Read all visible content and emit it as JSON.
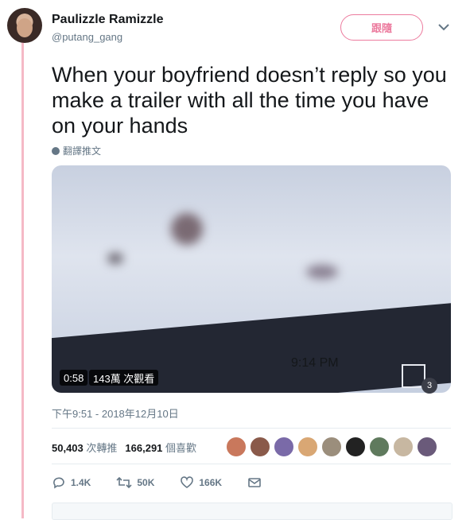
{
  "user": {
    "display_name": "Paulizzle Ramizzle",
    "handle": "@putang_gang"
  },
  "follow_button_label": "跟隨",
  "tweet": {
    "text": "When your boyfriend doesn’t reply so you make a trailer with all the time you have on your hands",
    "translate_label": "翻譯推文",
    "timestamp": "下午9:51 - 2018年12月10日"
  },
  "video": {
    "duration": "0:58",
    "views": "143萬 次觀看",
    "clock_text": "9:14 PM",
    "badge_number": "3"
  },
  "stats": {
    "retweets_count": "50,403",
    "retweets_label": "次轉推",
    "likes_count": "166,291",
    "likes_label": "個喜歡"
  },
  "actions": {
    "reply_count": "1.4K",
    "retweet_count": "50K",
    "like_count": "166K"
  },
  "colors": {
    "accent": "#e0245e",
    "text": "#14171a",
    "muted": "#657786",
    "thread_line": "#f5b9c6"
  },
  "liker_colors": [
    "#c9785c",
    "#8a5a4a",
    "#7a6aa8",
    "#d9a774",
    "#9b8e7c",
    "#222222",
    "#5f7a5d",
    "#c7b7a1",
    "#6a5a7a"
  ]
}
